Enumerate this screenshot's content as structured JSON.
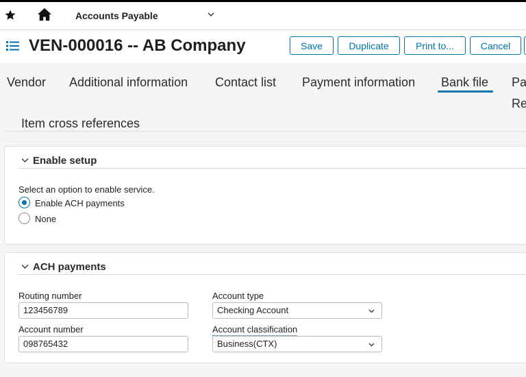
{
  "topbar": {
    "app_title": "Accounts Payable"
  },
  "header": {
    "record_title": "VEN-000016 -- AB Company",
    "buttons": {
      "save": "Save",
      "duplicate": "Duplicate",
      "print": "Print to...",
      "cancel": "Cancel"
    }
  },
  "tabs": [
    {
      "label": "Vendor"
    },
    {
      "label": "Additional information"
    },
    {
      "label": "Contact list"
    },
    {
      "label": "Payment information"
    },
    {
      "label": "Bank file"
    },
    {
      "label": "Pa"
    },
    {
      "label": "Re"
    }
  ],
  "subtab": {
    "label": "Item cross references"
  },
  "enable_setup": {
    "title": "Enable setup",
    "prompt": "Select an option to enable service.",
    "options": [
      {
        "label": "Enable ACH payments",
        "selected": true
      },
      {
        "label": "None",
        "selected": false
      }
    ]
  },
  "ach_payments": {
    "title": "ACH payments",
    "routing_number": {
      "label": "Routing number",
      "value": "123456789"
    },
    "account_number": {
      "label": "Account number",
      "value": "098765432"
    },
    "account_type": {
      "label": "Account type",
      "value": "Checking Account"
    },
    "account_classification": {
      "label": "Account classification",
      "value": "Business(CTX)"
    }
  },
  "colors": {
    "accent": "#0073b1",
    "background": "#f4f5f6",
    "card": "#ffffff"
  }
}
